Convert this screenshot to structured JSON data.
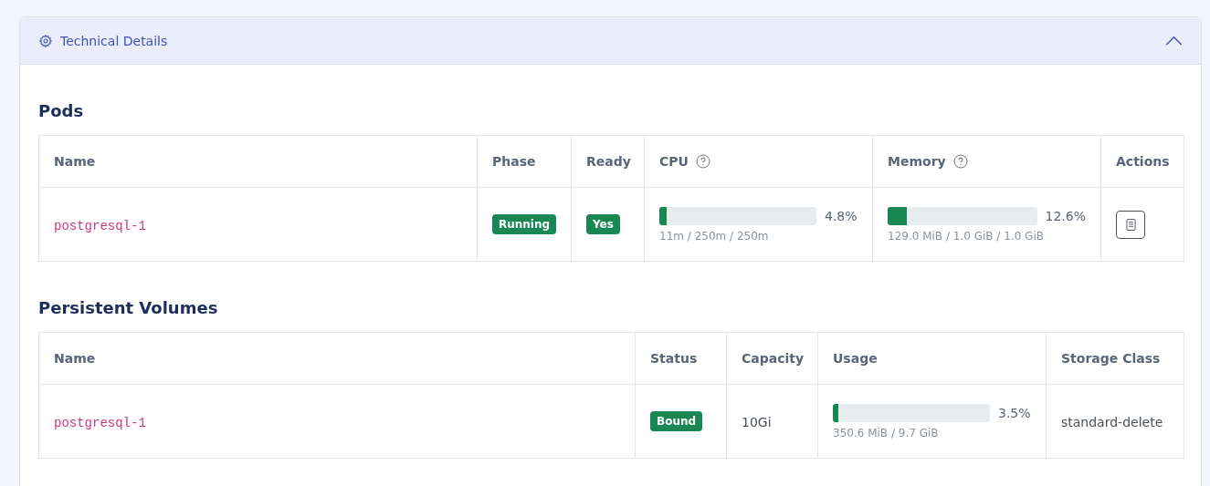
{
  "panel": {
    "title": "Technical Details",
    "expanded": true
  },
  "sections": [
    {
      "title": "Pods",
      "columns": [
        {
          "label": "Name",
          "help": false
        },
        {
          "label": "Phase",
          "help": false
        },
        {
          "label": "Ready",
          "help": false
        },
        {
          "label": "CPU",
          "help": true
        },
        {
          "label": "Memory",
          "help": true
        },
        {
          "label": "Actions",
          "help": false
        }
      ],
      "rows": [
        [
          {
            "kind": "mono",
            "text": "postgresql-1"
          },
          {
            "kind": "badge",
            "text": "Running",
            "color": "#198754"
          },
          {
            "kind": "badge",
            "text": "Yes",
            "color": "#198754"
          },
          {
            "kind": "usage",
            "level": 0.048,
            "percent": "4.8%",
            "detail": "11m / 250m / 250m"
          },
          {
            "kind": "usage",
            "level": 0.126,
            "percent": "12.6%",
            "detail": "129.0 MiB / 1.0 GiB / 1.0 GiB"
          },
          {
            "kind": "action"
          }
        ]
      ]
    },
    {
      "title": "Persistent Volumes",
      "columns": [
        {
          "label": "Name",
          "help": false
        },
        {
          "label": "Status",
          "help": false
        },
        {
          "label": "Capacity",
          "help": false
        },
        {
          "label": "Usage",
          "help": false
        },
        {
          "label": "Storage Class",
          "help": false
        }
      ],
      "rows": [
        [
          {
            "kind": "mono",
            "text": "postgresql-1"
          },
          {
            "kind": "badge",
            "text": "Bound",
            "color": "#198754"
          },
          {
            "kind": "text",
            "text": "10Gi"
          },
          {
            "kind": "usage",
            "level": 0.035,
            "percent": "3.5%",
            "detail": "350.6 MiB / 9.7 GiB"
          },
          {
            "kind": "text",
            "text": "standard-delete"
          }
        ]
      ]
    }
  ]
}
